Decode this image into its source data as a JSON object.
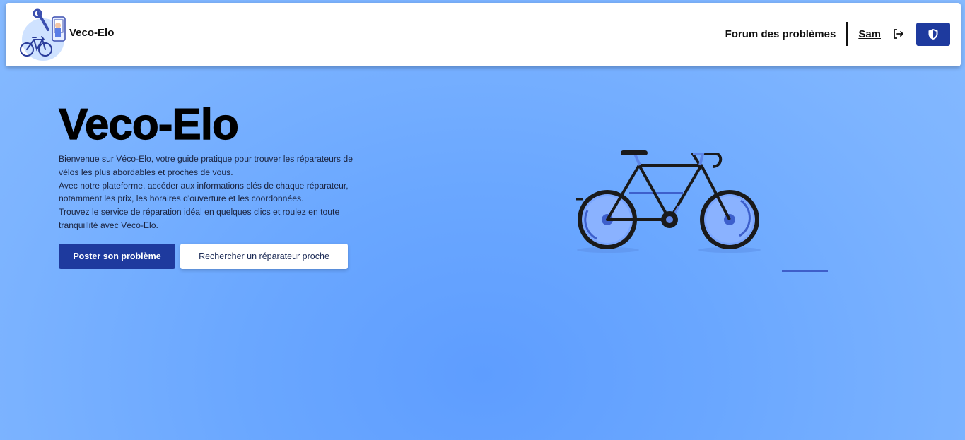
{
  "navbar": {
    "brand_name": "Veco-Elo",
    "forum_link": "Forum des problèmes",
    "user_name": "Sam"
  },
  "hero": {
    "title": "Veco-Elo",
    "paragraph_lines": [
      "Bienvenue sur Véco-Elo, votre guide pratique pour trouver les réparateurs de",
      "vélos les plus abordables et proches de vous.",
      "Avec notre plateforme, accéder aux informations clés de chaque réparateur,",
      "notamment les prix, les horaires d'ouverture et les coordonnées.",
      "Trouvez le service de réparation idéal en quelques clics et roulez en toute",
      "tranquillité avec Véco-Elo."
    ],
    "primary_button": "Poster son problème",
    "secondary_button": "Rechercher un réparateur proche"
  },
  "icons": {
    "logout": "logout-icon",
    "admin": "shield-icon",
    "logo": "bike-repair-logo",
    "illustration": "bicycle-illustration"
  },
  "colors": {
    "primary": "#1e3a9e",
    "background": "#6aa7ff",
    "accent_line": "#3e5ec9"
  }
}
